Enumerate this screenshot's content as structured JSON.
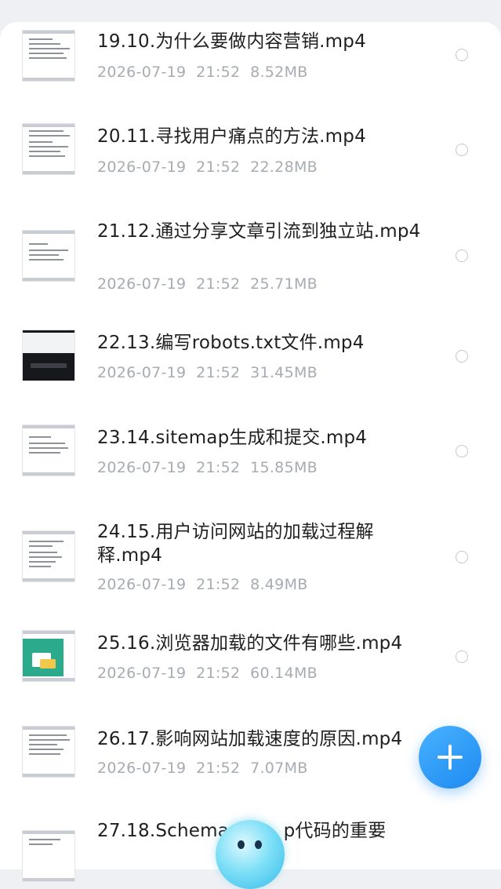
{
  "files": [
    {
      "name": "19.10.为什么要做内容营销.mp4",
      "date": "2026-07-19",
      "time": "21:52",
      "size": "8.52MB",
      "thumb": "doc"
    },
    {
      "name": "20.11.寻找用户痛点的方法.mp4",
      "date": "2026-07-19",
      "time": "21:52",
      "size": "22.28MB",
      "thumb": "doc"
    },
    {
      "name": "21.12.通过分享文章引流到独立站.mp4",
      "date": "2026-07-19",
      "time": "21:52",
      "size": "25.71MB",
      "thumb": "doc"
    },
    {
      "name": "22.13.编写robots.txt文件.mp4",
      "date": "2026-07-19",
      "time": "21:52",
      "size": "31.45MB",
      "thumb": "dark"
    },
    {
      "name": "23.14.sitemap生成和提交.mp4",
      "date": "2026-07-19",
      "time": "21:52",
      "size": "15.85MB",
      "thumb": "doc"
    },
    {
      "name": "24.15.用户访问网站的加载过程解释.mp4",
      "date": "2026-07-19",
      "time": "21:52",
      "size": "8.49MB",
      "thumb": "doc"
    },
    {
      "name": "25.16.浏览器加载的文件有哪些.mp4",
      "date": "2026-07-19",
      "time": "21:52",
      "size": "60.14MB",
      "thumb": "green"
    },
    {
      "name": "26.17.影响网站加载速度的原因.mp4",
      "date": "2026-07-19",
      "time": "21:52",
      "size": "7.07MB",
      "thumb": "doc"
    },
    {
      "name": "27.18.Schema　　　p代码的重要",
      "date": "",
      "time": "",
      "size": "",
      "thumb": "doc"
    }
  ],
  "icons": {
    "add": "plus-icon",
    "assistant": "assistant-mascot-icon",
    "select": "radio-circle-icon",
    "thumbnail": "video-thumbnail-icon"
  },
  "colors": {
    "title": "#1f1f1f",
    "meta": "#a7abb2",
    "accent": "#1e8af0",
    "background": "#ffffff"
  }
}
